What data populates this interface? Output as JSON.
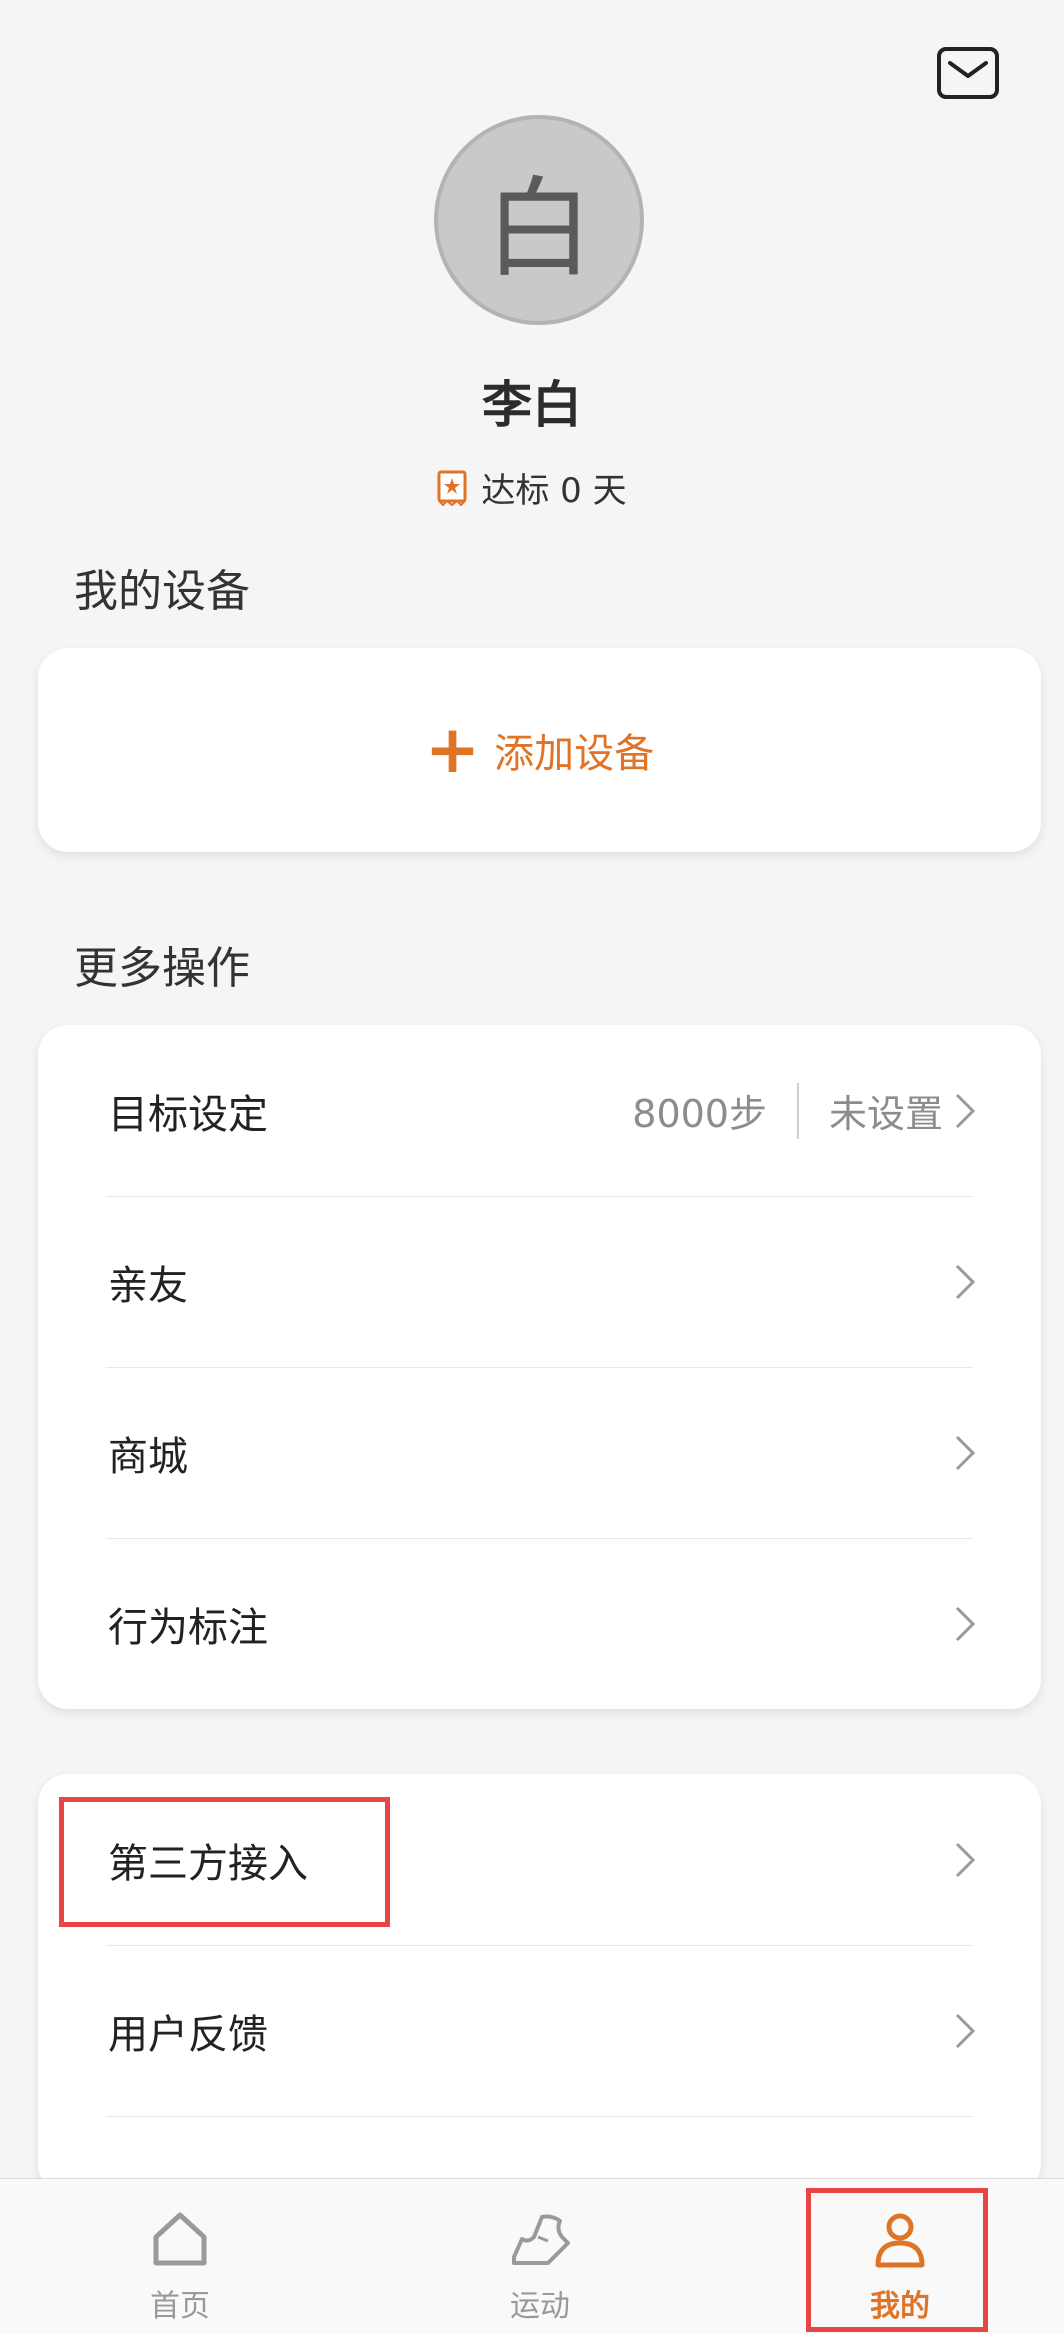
{
  "header": {
    "mail_icon": "mail-icon"
  },
  "profile": {
    "avatar_text": "白",
    "name": "李白",
    "achievement_text": "达标 0 天",
    "achievement_icon": "star-badge-icon"
  },
  "devices": {
    "section_title": "我的设备",
    "add_plus": "+",
    "add_label": "添加设备"
  },
  "more": {
    "section_title": "更多操作",
    "items": [
      {
        "label": "目标设定",
        "goal": "8000步",
        "status": "未设置"
      },
      {
        "label": "亲友"
      },
      {
        "label": "商城"
      },
      {
        "label": "行为标注"
      }
    ]
  },
  "extra": {
    "items": [
      {
        "label": "第三方接入"
      },
      {
        "label": "用户反馈"
      }
    ]
  },
  "tabbar": {
    "tabs": [
      {
        "label": "首页",
        "icon": "home-icon"
      },
      {
        "label": "运动",
        "icon": "shoe-icon"
      },
      {
        "label": "我的",
        "icon": "person-icon",
        "active": true
      }
    ]
  },
  "colors": {
    "accent": "#e07426",
    "highlight": "#e84545",
    "background": "#f5f5f5"
  }
}
